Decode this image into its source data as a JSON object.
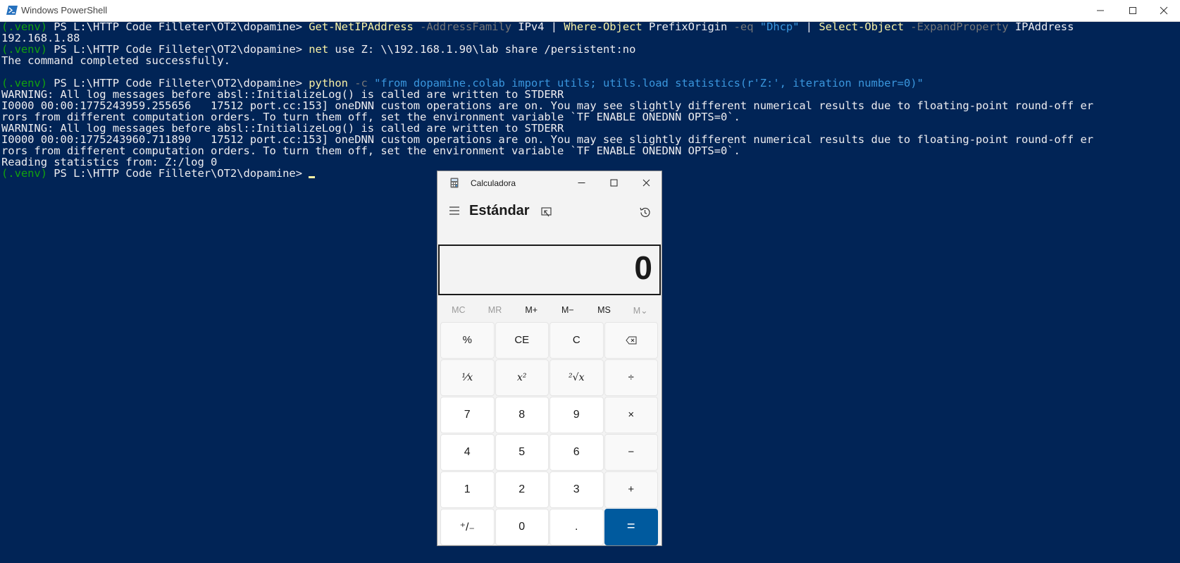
{
  "powershell": {
    "title": "Windows PowerShell",
    "lines": [
      [
        [
          "env",
          "(.venv) "
        ],
        [
          "plain",
          "PS L:\\HTTP_Code_Filleter\\OT2\\dopamine> "
        ],
        [
          "cmd",
          "Get-NetIPAddress"
        ],
        [
          "param",
          " -AddressFamily"
        ],
        [
          "plain",
          " IPv4 | "
        ],
        [
          "cmd",
          "Where-Object"
        ],
        [
          "plain",
          " PrefixOrigin "
        ],
        [
          "param",
          "-eq"
        ],
        [
          "plain",
          " "
        ],
        [
          "str",
          "\"Dhcp\""
        ],
        [
          "plain",
          " | "
        ],
        [
          "cmd",
          "Select-Object"
        ],
        [
          "param",
          " -ExpandProperty"
        ],
        [
          "plain",
          " IPAddress"
        ]
      ],
      [
        [
          "plain",
          "192.168.1.88"
        ]
      ],
      [
        [
          "env",
          "(.venv) "
        ],
        [
          "plain",
          "PS L:\\HTTP_Code_Filleter\\OT2\\dopamine> "
        ],
        [
          "cmd",
          "net"
        ],
        [
          "plain",
          " use Z: \\\\192.168.1.90\\lab_share /persistent:no"
        ]
      ],
      [
        [
          "plain",
          "The command completed successfully."
        ]
      ],
      [
        [
          "plain",
          ""
        ]
      ],
      [
        [
          "env",
          "(.venv) "
        ],
        [
          "plain",
          "PS L:\\HTTP_Code_Filleter\\OT2\\dopamine> "
        ],
        [
          "cmd",
          "python"
        ],
        [
          "param",
          " -c"
        ],
        [
          "plain",
          " "
        ],
        [
          "str",
          "\"from dopamine.colab import utils; utils.load_statistics(r'Z:', iteration_number=0)\""
        ]
      ],
      [
        [
          "plain",
          "WARNING: All log messages before absl::InitializeLog() is called are written to STDERR"
        ]
      ],
      [
        [
          "plain",
          "I0000 00:00:1775243959.255656   17512 port.cc:153] oneDNN custom operations are on. You may see slightly different numerical results due to floating-point round-off er"
        ]
      ],
      [
        [
          "plain",
          "rors from different computation orders. To turn them off, set the environment variable `TF_ENABLE_ONEDNN_OPTS=0`."
        ]
      ],
      [
        [
          "plain",
          "WARNING: All log messages before absl::InitializeLog() is called are written to STDERR"
        ]
      ],
      [
        [
          "plain",
          "I0000 00:00:1775243960.711890   17512 port.cc:153] oneDNN custom operations are on. You may see slightly different numerical results due to floating-point round-off er"
        ]
      ],
      [
        [
          "plain",
          "rors from different computation orders. To turn them off, set the environment variable `TF_ENABLE_ONEDNN_OPTS=0`."
        ]
      ],
      [
        [
          "plain",
          "Reading statistics from: Z:/log_0"
        ]
      ],
      [
        [
          "env",
          "(.venv) "
        ],
        [
          "plain",
          "PS L:\\HTTP_Code_Filleter\\OT2\\dopamine> "
        ],
        [
          "cursor",
          ""
        ]
      ]
    ]
  },
  "calculator": {
    "title": "Calculadora",
    "mode": "Estándar",
    "display": "0",
    "memory": [
      {
        "label": "MC",
        "enabled": false
      },
      {
        "label": "MR",
        "enabled": false
      },
      {
        "label": "M+",
        "enabled": true
      },
      {
        "label": "M−",
        "enabled": true
      },
      {
        "label": "MS",
        "enabled": true
      },
      {
        "label": "M⌄",
        "enabled": false
      }
    ],
    "keys": [
      {
        "label": "%",
        "kind": "op",
        "name": "percent"
      },
      {
        "label": "CE",
        "kind": "op",
        "name": "clear-entry"
      },
      {
        "label": "C",
        "kind": "op",
        "name": "clear"
      },
      {
        "label": "⌫",
        "kind": "op",
        "name": "backspace"
      },
      {
        "label": "¹⁄x",
        "kind": "fn",
        "name": "reciprocal"
      },
      {
        "label": "x²",
        "kind": "fn",
        "name": "square"
      },
      {
        "label": "²√x",
        "kind": "fn",
        "name": "square-root"
      },
      {
        "label": "÷",
        "kind": "op",
        "name": "divide"
      },
      {
        "label": "7",
        "kind": "num",
        "name": "digit-7"
      },
      {
        "label": "8",
        "kind": "num",
        "name": "digit-8"
      },
      {
        "label": "9",
        "kind": "num",
        "name": "digit-9"
      },
      {
        "label": "×",
        "kind": "op",
        "name": "multiply"
      },
      {
        "label": "4",
        "kind": "num",
        "name": "digit-4"
      },
      {
        "label": "5",
        "kind": "num",
        "name": "digit-5"
      },
      {
        "label": "6",
        "kind": "num",
        "name": "digit-6"
      },
      {
        "label": "−",
        "kind": "op",
        "name": "subtract"
      },
      {
        "label": "1",
        "kind": "num",
        "name": "digit-1"
      },
      {
        "label": "2",
        "kind": "num",
        "name": "digit-2"
      },
      {
        "label": "3",
        "kind": "num",
        "name": "digit-3"
      },
      {
        "label": "+",
        "kind": "op",
        "name": "add"
      },
      {
        "label": "⁺/₋",
        "kind": "num",
        "name": "negate"
      },
      {
        "label": "0",
        "kind": "num",
        "name": "digit-0"
      },
      {
        "label": ".",
        "kind": "num",
        "name": "decimal"
      },
      {
        "label": "=",
        "kind": "eq",
        "name": "equals"
      }
    ]
  },
  "colors": {
    "console_bg": "#012456",
    "env_green": "#13a10e",
    "cmd_yellow": "#f9f1a5",
    "param_gray": "#767676",
    "string_blue": "#3a96dd",
    "equals_blue": "#005a9e"
  }
}
